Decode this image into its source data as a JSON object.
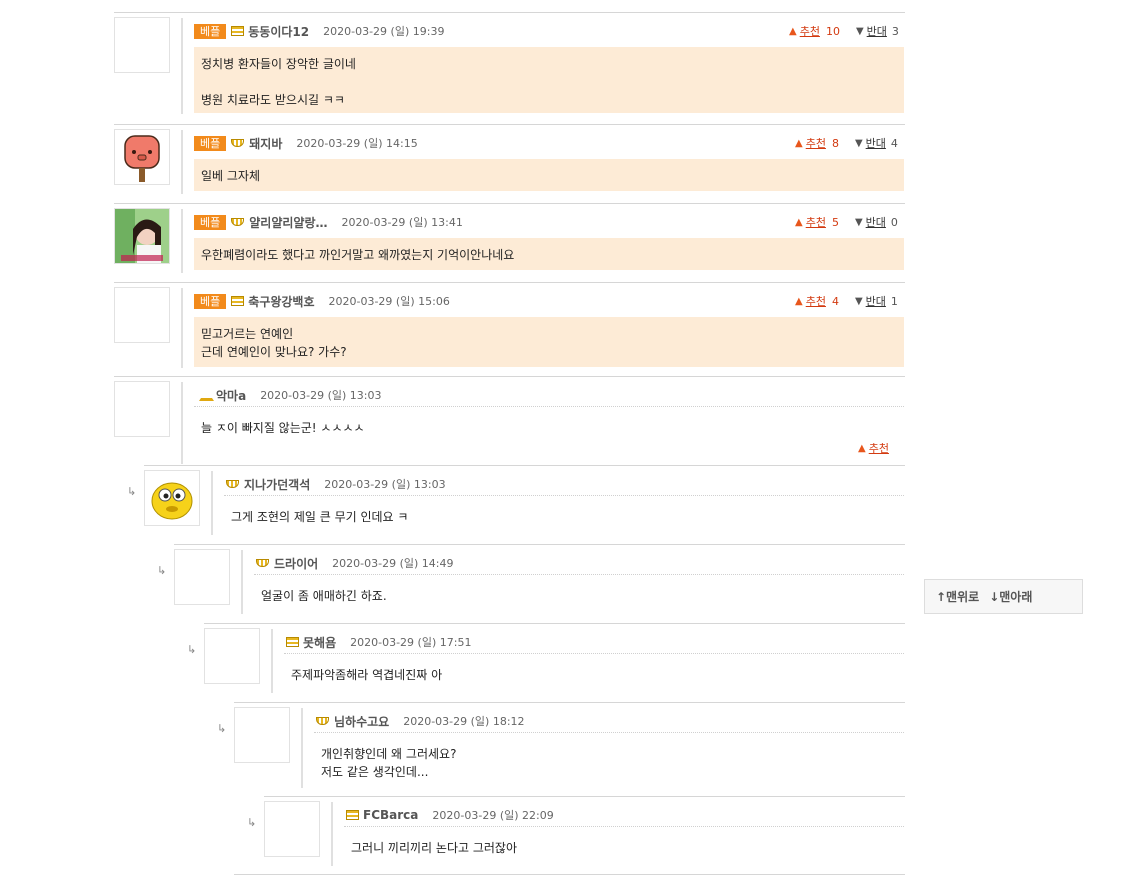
{
  "badge_label": "베플",
  "vote_labels": {
    "up": "추천",
    "down": "반대"
  },
  "best_comments": [
    {
      "nick": "동동이다12",
      "date": "2020-03-29 (일) 19:39",
      "up": "10",
      "down": "3",
      "lines": [
        "정치병 환자들이 장악한 글이네",
        "병원 치료라도 받으시길 ㅋㅋ"
      ]
    },
    {
      "nick": "돼지바",
      "date": "2020-03-29 (일) 14:15",
      "up": "8",
      "down": "4",
      "lines": [
        "일베 그자체"
      ]
    },
    {
      "nick": "얄리얄리얄랑…",
      "date": "2020-03-29 (일) 13:41",
      "up": "5",
      "down": "0",
      "lines": [
        "우한폐렴이라도 했다고 까인거말고 왜까였는지 기억이안나네요"
      ]
    },
    {
      "nick": "축구왕강백호",
      "date": "2020-03-29 (일) 15:06",
      "up": "4",
      "down": "1",
      "lines": [
        "믿고거르는 연예인",
        "근데 연예인이 맞나요? 가수?"
      ]
    }
  ],
  "thread": [
    {
      "nick": "악마a",
      "date": "2020-03-29 (일) 13:03",
      "lines": [
        "늘 ㅈ이 빠지질 않는군! ㅅㅅㅅㅅ"
      ],
      "up_label": "추천"
    },
    {
      "nick": "지나가던객석",
      "date": "2020-03-29 (일) 13:03",
      "lines": [
        "그게 조현의 제일 큰 무기 인데요 ㅋ"
      ]
    },
    {
      "nick": "드라이어",
      "date": "2020-03-29 (일) 14:49",
      "lines": [
        "얼굴이 좀 애매하긴 하죠."
      ]
    },
    {
      "nick": "못해욤",
      "date": "2020-03-29 (일) 17:51",
      "lines": [
        "주제파악좀해라 역겹네진짜 아"
      ]
    },
    {
      "nick": "님하수고요",
      "date": "2020-03-29 (일) 18:12",
      "lines": [
        "개인취향인데 왜 그러세요?",
        "저도 같은 생각인데..."
      ]
    },
    {
      "nick": "FCBarca",
      "date": "2020-03-29 (일) 22:09",
      "lines": [
        "그러니 끼리끼리 논다고 그러잖아"
      ]
    }
  ],
  "reply_arrow": "↳",
  "scroll_nav": {
    "top": "↑맨위로",
    "bottom": "↓맨아래"
  }
}
